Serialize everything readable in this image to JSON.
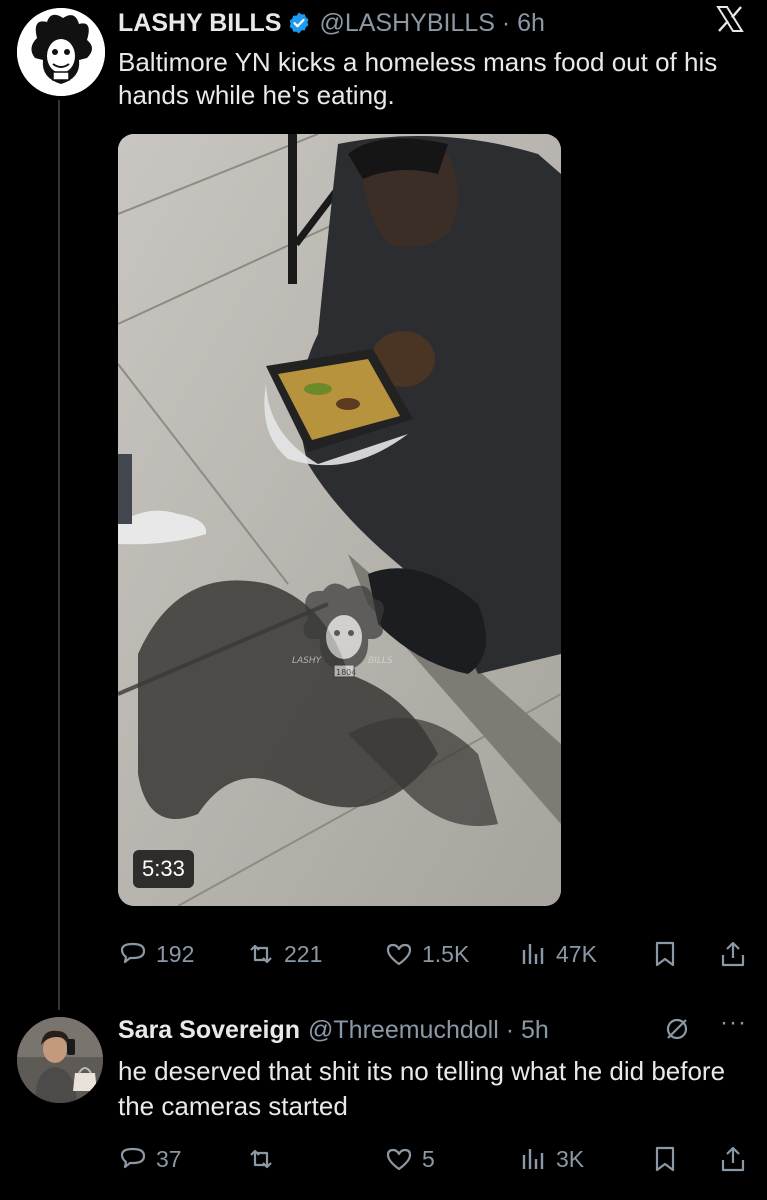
{
  "tweet": {
    "author_name": "LASHY BILLS",
    "handle_time": "@LASHYBILLS · 6h",
    "text": "Baltimore YN kicks a homeless mans food out of his hands while he's eating.",
    "video_duration": "5:33",
    "watermark": {
      "left": "LASHY",
      "right": "BILLS",
      "year": "1804"
    },
    "stats": {
      "replies": "192",
      "retweets": "221",
      "likes": "1.5K",
      "views": "47K"
    }
  },
  "reply": {
    "author_name": "Sara Sovereign",
    "handle_time": "@Threemuchdoll · 5h",
    "text": "he deserved that shit its no telling what he did before the cameras started",
    "more": "···",
    "stats": {
      "replies": "37",
      "retweets": "",
      "likes": "5",
      "views": "3K"
    }
  },
  "colors": {
    "background": "#000000",
    "text": "#e7e9ea",
    "muted": "#8b98a5",
    "verified": "#1d9bf0"
  },
  "icons": [
    "x-logo-icon",
    "verified-badge-icon",
    "reply-icon",
    "retweet-icon",
    "like-icon",
    "views-icon",
    "bookmark-icon",
    "share-icon",
    "mute-icon",
    "more-icon"
  ]
}
